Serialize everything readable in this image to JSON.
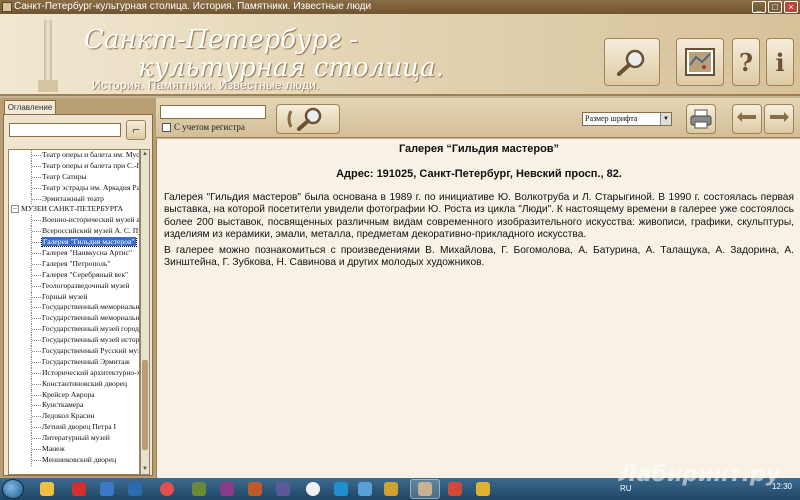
{
  "window": {
    "title": "Санкт-Петербург-культурная столица. История. Памятники. Известные люди"
  },
  "header": {
    "title_line1": "Санкт-Петербург -",
    "title_line2": "культурная столица.",
    "subtitle": "История. Памятники. Известные люди.",
    "help_label": "?",
    "info_label": "i"
  },
  "sidebar": {
    "tab_label": "Оглавление",
    "tree": [
      {
        "label": "Театр оперы и балета им. Мусоргского",
        "level": 2
      },
      {
        "label": "Театр оперы и балета при С.-Петербургской консерватории",
        "level": 2
      },
      {
        "label": "Театр Сатиры",
        "level": 2
      },
      {
        "label": "Театр эстрады им. Аркадия Райкина",
        "level": 2
      },
      {
        "label": "Эрмитажный театр",
        "level": 2
      },
      {
        "label": "МУЗЕИ САНКТ-ПЕТЕРБУРГА",
        "level": 1
      },
      {
        "label": "Военно-исторический музей артиллерии",
        "level": 2
      },
      {
        "label": "Всероссийский музей А. С. Пушкина",
        "level": 2
      },
      {
        "label": "Галерея \"Гильдия мастеров\"",
        "level": 2,
        "selected": true
      },
      {
        "label": "Галерея \"Наивкусна Артис\"",
        "level": 2
      },
      {
        "label": "Галерея \"Петрополь\"",
        "level": 2
      },
      {
        "label": "Галерея \"Серебряный век\"",
        "level": 2
      },
      {
        "label": "Геологоразведочный музей",
        "level": 2
      },
      {
        "label": "Горный музей",
        "level": 2
      },
      {
        "label": "Государственный мемориальный музей",
        "level": 2
      },
      {
        "label": "Государственный мемориальный музей",
        "level": 2
      },
      {
        "label": "Государственный музей городской скульптуры",
        "level": 2
      },
      {
        "label": "Государственный музей истории",
        "level": 2
      },
      {
        "label": "Государственный Русский музей",
        "level": 2
      },
      {
        "label": "Государственный Эрмитаж",
        "level": 2
      },
      {
        "label": "Исторический архитектурно-художественный музей",
        "level": 2
      },
      {
        "label": "Константиновский дворец",
        "level": 2
      },
      {
        "label": "Крейсер Аврора",
        "level": 2
      },
      {
        "label": "Кунсткамера",
        "level": 2
      },
      {
        "label": "Ледокол Красин",
        "level": 2
      },
      {
        "label": "Летний дворец Петра I",
        "level": 2
      },
      {
        "label": "Литературный музей",
        "level": 2
      },
      {
        "label": "Манеж",
        "level": 2
      },
      {
        "label": "Меншиковский дворец",
        "level": 2
      }
    ]
  },
  "toolbar": {
    "search_value": "",
    "case_label": "С учетом регистра",
    "font_size_label": "Размер шрифта"
  },
  "article": {
    "title": "Галерея “Гильдия мастеров”",
    "address": "Адрес: 191025, Санкт-Петербург, Невский просп., 82.",
    "paragraphs": [
      "Галерея \"Гильдия мастеров\" была основана в 1989 г. по инициативе Ю. Волкотруба и Л. Старыгиной. В 1990 г. состоялась первая выставка, на которой посетители увидели фотографии Ю. Роста из цикла \"Люди\". К настоящему времени в галерее уже состоялось более 200 выставок, посвященных различным видам современного изобразительного искусства: живописи, графики, скульптуры, изделиям из керамики, эмали, металла, предметам декоративно-прикладного искусства.",
      "В галерее можно познакомиться с произведениями В. Михайлова, Г. Богомолова, А. Батурина, А. Талащука, А. Задорина, А. Зинштейна, Г. Зубкова, Н. Савинова и других молодых художников."
    ]
  },
  "taskbar": {
    "language": "RU",
    "time": "12:30"
  },
  "watermark": "Лабиринт.ру",
  "colors": {
    "header_bg": "#e5d6b6",
    "content_bg": "#f8f2e6",
    "selection": "#3a6fc4",
    "taskbar": "#1f4663"
  }
}
